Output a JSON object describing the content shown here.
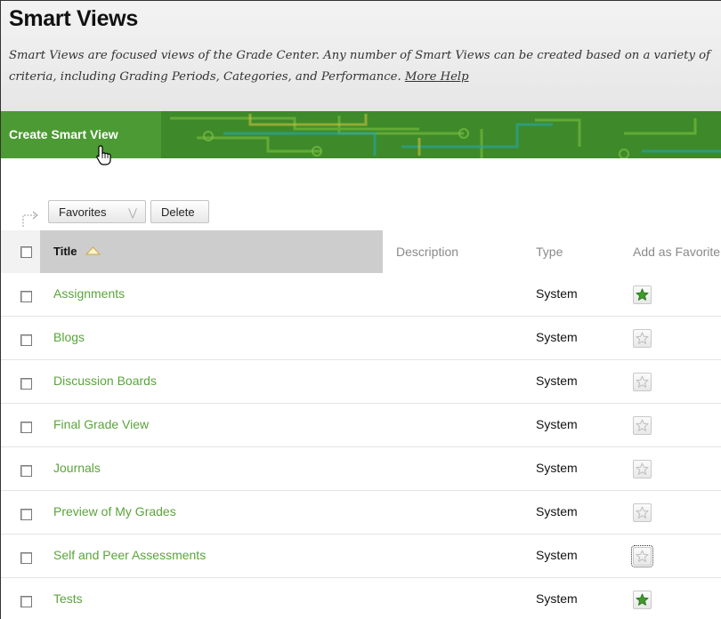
{
  "header": {
    "title": "Smart Views",
    "description_line1": "Smart Views are focused views of the Grade Center. Any number of Smart Views can be created based on a variety of",
    "description_line2": "criteria, including Grading Periods, Categories, and Performance.",
    "help_link": "More Help"
  },
  "banner": {
    "create_label": "Create Smart View"
  },
  "actions": {
    "favorites_label": "Favorites",
    "delete_label": "Delete",
    "favorites_chevron": "chevron-down-icon"
  },
  "table": {
    "columns": {
      "title": "Title",
      "description": "Description",
      "type": "Type",
      "favorite": "Add as Favorite"
    },
    "sort": "ascending",
    "rows": [
      {
        "title": "Assignments",
        "type": "System",
        "favorite": true,
        "focused": false
      },
      {
        "title": "Blogs",
        "type": "System",
        "favorite": false,
        "focused": false
      },
      {
        "title": "Discussion Boards",
        "type": "System",
        "favorite": false,
        "focused": false
      },
      {
        "title": "Final Grade View",
        "type": "System",
        "favorite": false,
        "focused": false
      },
      {
        "title": "Journals",
        "type": "System",
        "favorite": false,
        "focused": false
      },
      {
        "title": "Preview of My Grades",
        "type": "System",
        "favorite": false,
        "focused": false
      },
      {
        "title": "Self and Peer Assessments",
        "type": "System",
        "favorite": false,
        "focused": true
      },
      {
        "title": "Tests",
        "type": "System",
        "favorite": true,
        "focused": false
      }
    ]
  },
  "colors": {
    "link": "#5aa43b",
    "banner": "#3e8a2a",
    "banner_button": "#4c9a33",
    "star_on": "#3f9a2d",
    "star_off": "#bdbdbd"
  }
}
